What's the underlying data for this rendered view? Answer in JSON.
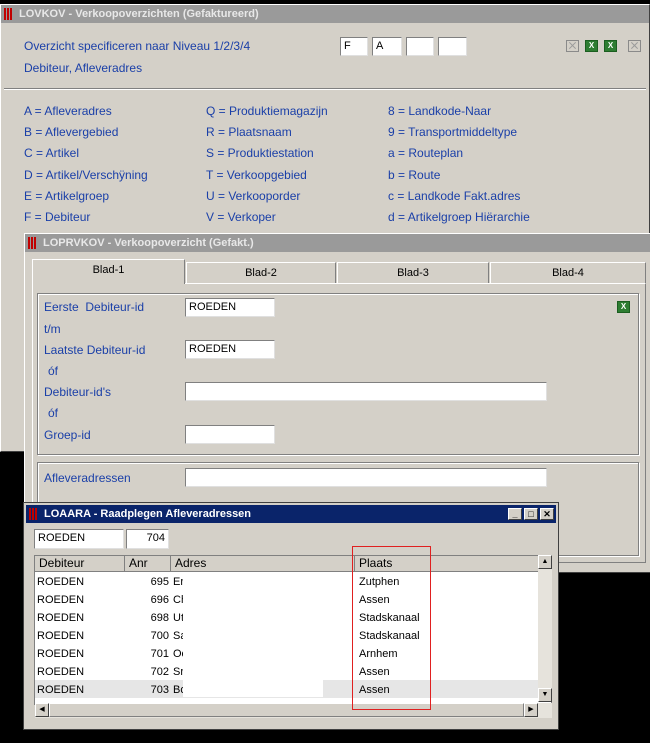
{
  "win1": {
    "title": "LOVKOV - Verkoopoverzichten (Gefaktureerd)",
    "label_line1": "Overzicht specificeren naar Niveau 1/2/3/4",
    "label_line2": "Debiteur, Afleveradres",
    "level_inputs": [
      "F",
      "A",
      "",
      ""
    ],
    "legend": [
      [
        "A = Afleveradres",
        "B = Aflevergebied",
        "C = Artikel",
        "D = Artikel/Verschÿning",
        "E = Artikelgroep",
        "F = Debiteur"
      ],
      [
        "Q = Produktiemagazijn",
        "R = Plaatsnaam",
        "S = Produktiestation",
        "T = Verkoopgebied",
        "U = Verkooporder",
        "V = Verkoper"
      ],
      [
        "8 = Landkode-Naar",
        "9 = Transportmiddeltype",
        "a = Routeplan",
        "b = Route",
        "c = Landkode Fakt.adres",
        "d = Artikelgroep Hiërarchie"
      ]
    ]
  },
  "win2": {
    "title": "LOPRVKOV - Verkoopoverzicht (Gefakt.)",
    "tabs": [
      "Blad-1",
      "Blad-2",
      "Blad-3",
      "Blad-4"
    ],
    "labels": {
      "eerste": "Eerste  Debiteur-id",
      "tm": "t/m",
      "laatste": "Laatste Debiteur-id",
      "of1": "óf",
      "ids": "Debiteur-id's",
      "of2": "óf",
      "groep": "Groep-id",
      "aflever": "Afleveradressen"
    },
    "values": {
      "eerste": "ROEDEN",
      "laatste": "ROEDEN",
      "ids": "",
      "groep": "",
      "aflever": ""
    }
  },
  "win3": {
    "title": "LOAARA - Raadplegen Afleveradressen",
    "search_debiteur": "ROEDEN",
    "search_nr": "704",
    "columns": [
      "Debiteur",
      "Anr",
      "Adres",
      "Plaats"
    ],
    "rows": [
      {
        "debiteur": "ROEDEN",
        "nr": "695",
        "adres": "Er",
        "plaats": "Zutphen"
      },
      {
        "debiteur": "ROEDEN",
        "nr": "696",
        "adres": "Ch",
        "plaats": "Assen"
      },
      {
        "debiteur": "ROEDEN",
        "nr": "698",
        "adres": "Ut",
        "plaats": "Stadskanaal"
      },
      {
        "debiteur": "ROEDEN",
        "nr": "700",
        "adres": "Sa",
        "plaats": "Stadskanaal"
      },
      {
        "debiteur": "ROEDEN",
        "nr": "701",
        "adres": "Oc",
        "plaats": "Arnhem"
      },
      {
        "debiteur": "ROEDEN",
        "nr": "702",
        "adres": "Sr",
        "plaats": "Assen"
      },
      {
        "debiteur": "ROEDEN",
        "nr": "703",
        "adres": "Bo",
        "plaats": "Assen"
      }
    ]
  },
  "colors": {
    "label_blue": "#1a3fa8",
    "highlight_red": "#e02020",
    "active_title": "#0a246a"
  }
}
